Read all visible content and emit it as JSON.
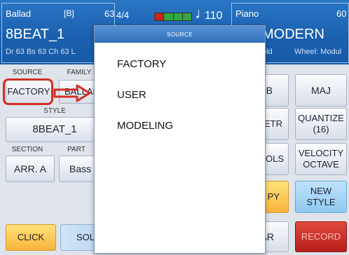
{
  "header": {
    "style_type": "Ballad",
    "style_bank": "[B]",
    "style_number": "63",
    "style_name": "8BEAT_1",
    "style_info": "Dr 63  Bs 63  Ch 63  L",
    "time_signature": "4/4",
    "beat_indicator": {
      "beats": 4,
      "current_beat": 1,
      "colors": {
        "current": "#c8251f",
        "other": "#33a640"
      }
    },
    "tempo_icon": "note-icon",
    "tempo": "110",
    "voice_type": "Piano",
    "voice_number": "60",
    "voice_name": "MODERN",
    "voice_hold": "old",
    "voice_wheel": "Wheel: Modul"
  },
  "labels": {
    "source": "SOURCE",
    "family": "FAMILY",
    "style": "STYLE",
    "section": "SECTION",
    "part": "PART"
  },
  "buttons": {
    "source": "FACTORY",
    "family": "BALLAD",
    "style": "8BEAT_1",
    "section": "ARR. A",
    "part": "Bass",
    "click": "CLICK",
    "solo": "SOLO",
    "arr_b": ". B",
    "maj": "MAJ",
    "metr": "METR",
    "quantize_line1": "QUANTIZE",
    "quantize_line2": "(16)",
    "rols": "ROLS",
    "velocity_line1": "VELOCITY",
    "velocity_line2": "OCTAVE",
    "py": "PY",
    "new_style": "NEW STYLE",
    "ar": "AR",
    "record": "RECORD"
  },
  "colors": {
    "header_bg": "#1a5fae",
    "highlight": "#d32e26",
    "record_bg": "#b51e1b",
    "click_bg": "#f6b43b",
    "blue_btn_bg": "#8fc9f1"
  },
  "modal": {
    "title": "SOURCE",
    "options": [
      "FACTORY",
      "USER",
      "MODELING"
    ]
  }
}
